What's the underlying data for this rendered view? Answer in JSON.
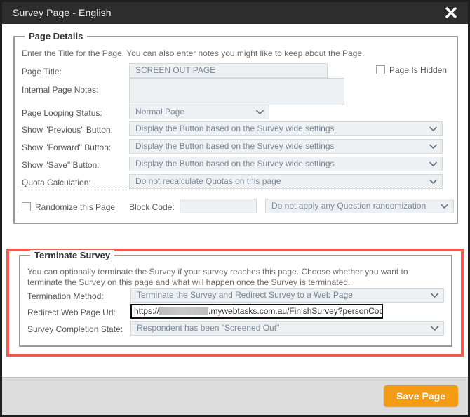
{
  "window": {
    "title": "Survey Page",
    "title_separator": "-",
    "language": "English",
    "close_icon": "close-icon"
  },
  "page_details": {
    "legend": "Page Details",
    "description": "Enter the Title for the Page. You can also enter notes you might like to keep about the Page.",
    "fields": {
      "page_title_label": "Page Title:",
      "page_title_value": "SCREEN OUT PAGE",
      "internal_notes_label": "Internal Page Notes:",
      "internal_notes_value": "",
      "page_looping_label": "Page Looping Status:",
      "page_looping_value": "Normal Page",
      "show_previous_label": "Show \"Previous\" Button:",
      "show_previous_value": "Display the Button based on the Survey wide settings",
      "show_forward_label": "Show \"Forward\" Button:",
      "show_forward_value": "Display the Button based on the Survey wide settings",
      "show_save_label": "Show \"Save\" Button:",
      "show_save_value": "Display the Button based on the Survey wide settings",
      "quota_calculation_label": "Quota Calculation:",
      "quota_calculation_value": "Do not recalculate Quotas on this page"
    },
    "page_is_hidden_label": "Page Is Hidden",
    "page_is_hidden_checked": false,
    "randomize_label": "Randomize this Page",
    "randomize_checked": false,
    "block_code_label": "Block Code:",
    "block_code_value": "",
    "question_randomization_value": "Do not apply any Question randomization"
  },
  "terminate_survey": {
    "legend": "Terminate Survey",
    "description": "You can optionally terminate the Survey if your survey reaches this page. Choose whether you want to terminate the Survey on this page and what will happen once the Survey is terminated.",
    "termination_method_label": "Termination Method:",
    "termination_method_value": "Terminate the Survey and Redirect Survey to a Web Page",
    "redirect_url_label": "Redirect Web Page Url:",
    "redirect_url_prefix": "https://",
    "redirect_url_suffix": ".mywebtasks.com.au/FinishSurvey?personCod",
    "completion_state_label": "Survey Completion State:",
    "completion_state_value": "Respondent has been \"Screened Out\""
  },
  "footer": {
    "save_label": "Save Page"
  },
  "colors": {
    "titlebar": "#2d2d2d",
    "accent_save": "#f59a13",
    "highlight_border": "#f05b4f",
    "field_bg": "#eef1f4"
  }
}
